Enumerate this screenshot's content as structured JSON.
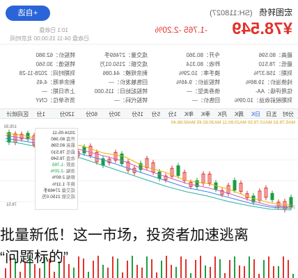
{
  "header": {
    "name": "宏图转债",
    "code": "(SH:118027)",
    "price": "¥78.549",
    "change": "-1.765 -2.20%",
    "add_button": "+自选",
    "meta_1": "10:1 已收盘",
    "meta_2": "已收盘 04-11 15:00:00 北京时间"
  },
  "stats": {
    "rows": [
      [
        "最高：80.596",
        "今开：80.360",
        "成交量：27469手",
        "转股价：62.980"
      ],
      [
        "最低：78.510",
        "昨收：80.314",
        "成交额：2150.01万",
        "转股值：30.560"
      ],
      [
        "到期：158.37%",
        "换手率：10.29%",
        "剩余规模：44.086",
        "到期时间：2028-11-28"
      ],
      [
        "纯债溢价：19.86%",
        "转股溢价：9.46%",
        "回售触发价：—",
        "剩余年限：4.45"
      ],
      [
        "信用评级：AA-",
        "债券类型：—",
        "转股起始日：115.000",
        "上市日期：—"
      ],
      [
        "到期税前收益：10.09%",
        "回售价：—",
        "转股代码：—",
        "货币单位：CNY"
      ]
    ]
  },
  "tabs": [
    "分时",
    "五日",
    "日K",
    "周K",
    "月K",
    "季K",
    "年K",
    "1分",
    "5分",
    "15分",
    "30分",
    "60分",
    "120分",
    "1分",
    "区间统计",
    "全屏"
  ],
  "active_tab": "日K",
  "legend": {
    "text": "MA5:78.82  MA10:79.50  MA20:80.11  MA30:82.45  MA60:86.40"
  },
  "tooltip": {
    "date": "2024-05-11",
    "items": [
      [
        "开盘",
        "80.360"
      ],
      [
        "最高",
        "80.596"
      ],
      [
        "最低",
        "78.510"
      ],
      [
        "收盘",
        "78.549"
      ],
      [
        "涨跌",
        "-1.765"
      ],
      [
        "涨幅",
        "-2.20%"
      ],
      [
        "振幅",
        "2.60%"
      ],
      [
        "换手",
        "1.11%"
      ],
      [
        "成交量",
        "27469手"
      ],
      [
        "成交额",
        "2150.0万"
      ]
    ]
  },
  "axis": {
    "high": "105.50",
    "low": "78.51"
  },
  "caption": {
    "line1": "批量新低！这一市场，投资者加速逃离",
    "line2": "“问题标的”"
  },
  "colors": {
    "up": "#e2312b",
    "down": "#1a9e43",
    "accent": "#2a64d8"
  }
}
